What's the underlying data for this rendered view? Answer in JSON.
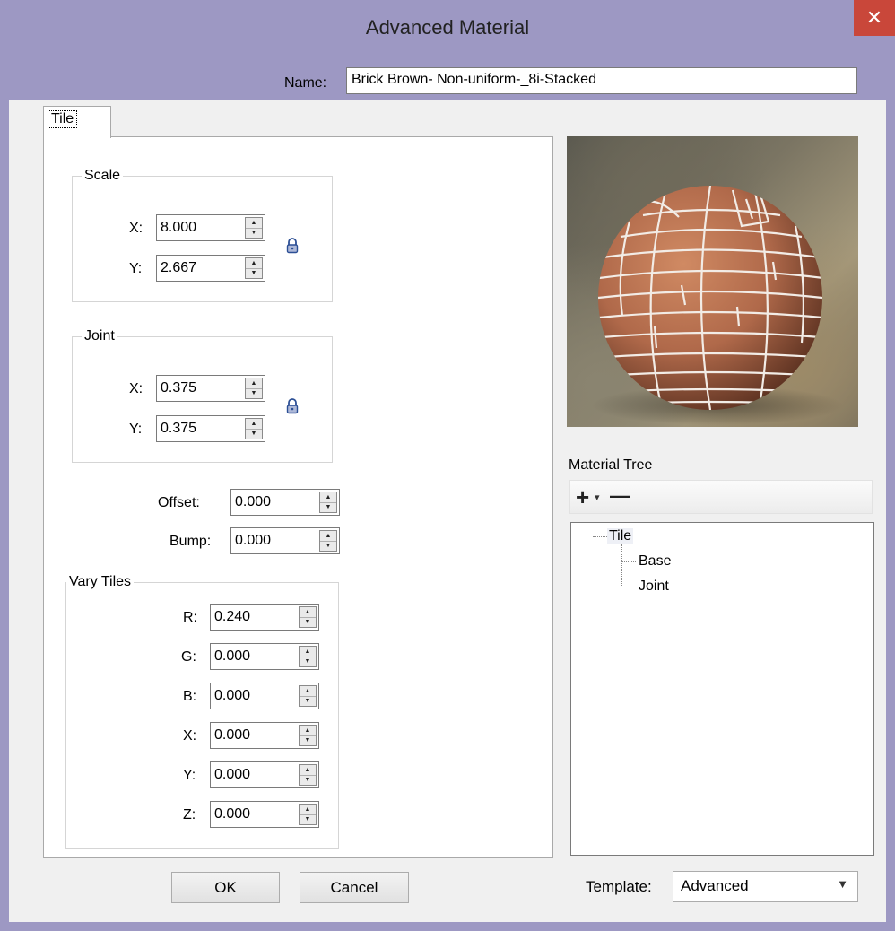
{
  "window": {
    "title": "Advanced Material",
    "close_glyph": "✕"
  },
  "name_field": {
    "label": "Name:",
    "value": "Brick Brown- Non-uniform-_8i-Stacked"
  },
  "tab": {
    "label": "Tile"
  },
  "scale": {
    "title": "Scale",
    "x": {
      "label": "X:",
      "value": "8.000"
    },
    "y": {
      "label": "Y:",
      "value": "2.667"
    }
  },
  "joint": {
    "title": "Joint",
    "x": {
      "label": "X:",
      "value": "0.375"
    },
    "y": {
      "label": "Y:",
      "value": "0.375"
    }
  },
  "offset": {
    "label": "Offset:",
    "value": "0.000"
  },
  "bump": {
    "label": "Bump:",
    "value": "0.000"
  },
  "vary_tiles": {
    "title": "Vary Tiles",
    "r": {
      "label": "R:",
      "value": "0.240"
    },
    "g": {
      "label": "G:",
      "value": "0.000"
    },
    "b": {
      "label": "B:",
      "value": "0.000"
    },
    "x": {
      "label": "X:",
      "value": "0.000"
    },
    "y": {
      "label": "Y:",
      "value": "0.000"
    },
    "z": {
      "label": "Z:",
      "value": "0.000"
    }
  },
  "material_tree": {
    "label": "Material Tree",
    "add_glyph": "+",
    "add_dropdown_glyph": "▾",
    "remove_glyph": "—",
    "root": "Tile",
    "children": [
      "Base",
      "Joint"
    ]
  },
  "buttons": {
    "ok": "OK",
    "cancel": "Cancel"
  },
  "template": {
    "label": "Template:",
    "value": "Advanced",
    "arrow": "▼"
  },
  "spin": {
    "up": "▲",
    "down": "▼"
  },
  "colors": {
    "titlebar": "#9d98c3",
    "close": "#c9473a",
    "brick": "#b9714e"
  }
}
